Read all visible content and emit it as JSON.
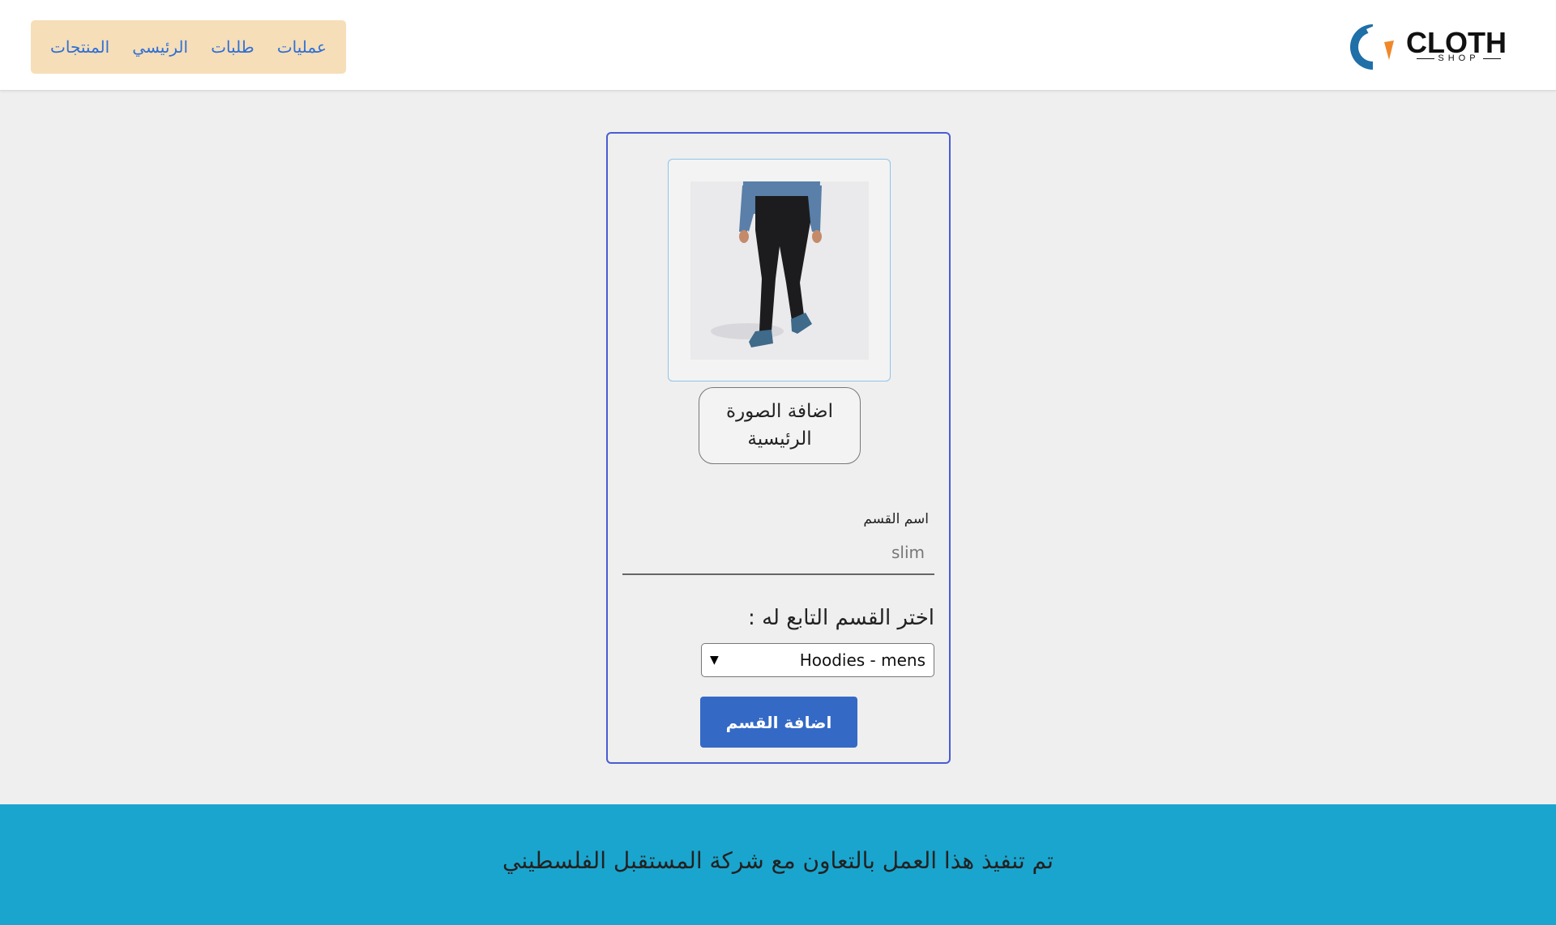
{
  "nav": {
    "items": [
      {
        "label": "عمليات"
      },
      {
        "label": "طلبات"
      },
      {
        "label": "الرئيسي"
      },
      {
        "label": "المنتجات"
      }
    ]
  },
  "brand": {
    "name": "CLOTH",
    "sub": "SHOP",
    "colors": {
      "blue": "#1f6fa8",
      "orange": "#f0882a"
    }
  },
  "form": {
    "upload_label": "اضافة الصورة الرئيسية",
    "name_label": "اسم القسم",
    "name_value": "slim",
    "parent_label": "اختر القسم التابع له :",
    "parent_selected": "Hoodies - mens",
    "submit_label": "اضافة القسم",
    "image_icon": "product-photo-pants"
  },
  "footer": {
    "text": "تم تنفيذ هذا العمل بالتعاون مع شركة المستقبل الفلسطيني"
  }
}
